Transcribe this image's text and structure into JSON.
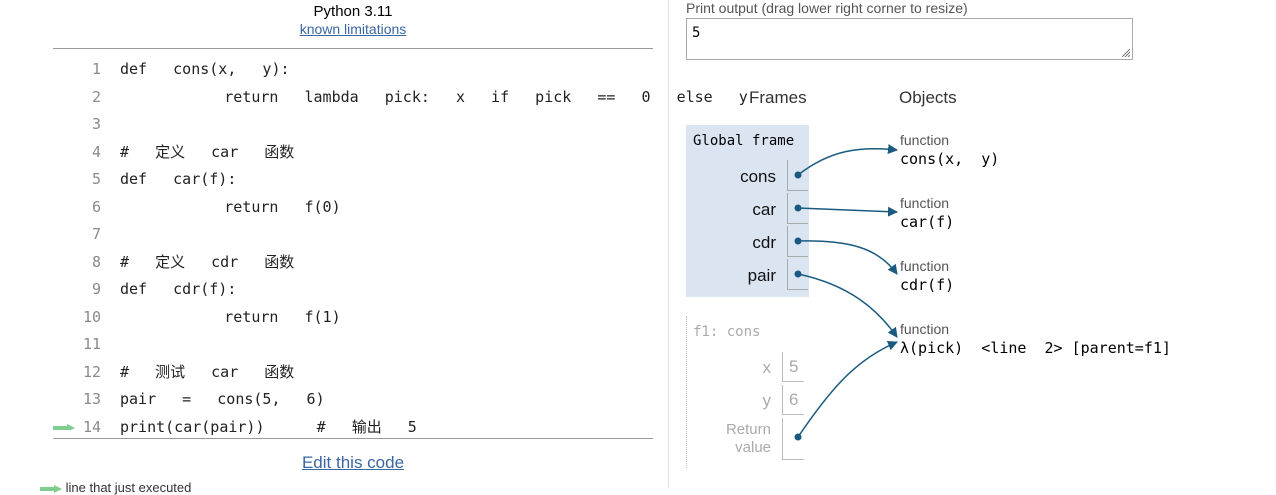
{
  "header": {
    "title": "Python 3.11",
    "limitations_link": "known limitations"
  },
  "code": {
    "lines": [
      {
        "n": "1",
        "text": "def  cons(x,  y):"
      },
      {
        "n": "2",
        "text": "        return  lambda  pick:  x  if  pick  ==  0  else  y"
      },
      {
        "n": "3",
        "text": ""
      },
      {
        "n": "4",
        "text": "#  定义  car  函数"
      },
      {
        "n": "5",
        "text": "def  car(f):"
      },
      {
        "n": "6",
        "text": "        return  f(0)"
      },
      {
        "n": "7",
        "text": ""
      },
      {
        "n": "8",
        "text": "#  定义  cdr  函数"
      },
      {
        "n": "9",
        "text": "def  cdr(f):"
      },
      {
        "n": "10",
        "text": "        return  f(1)"
      },
      {
        "n": "11",
        "text": ""
      },
      {
        "n": "12",
        "text": "#  测试  car  函数"
      },
      {
        "n": "13",
        "text": "pair  =  cons(5,  6)"
      },
      {
        "n": "14",
        "text": "print(car(pair))    #  输出  5"
      }
    ],
    "current_line": "14"
  },
  "edit_link": "Edit this code",
  "legend_text": "line that just executed",
  "output": {
    "label": "Print output (drag lower right corner to resize)",
    "value": "5"
  },
  "viz": {
    "frames_header": "Frames",
    "objects_header": "Objects",
    "global_frame": {
      "title": "Global frame",
      "vars": [
        "cons",
        "car",
        "cdr",
        "pair"
      ]
    },
    "objects": [
      {
        "type": "function",
        "value": "cons(x,  y)"
      },
      {
        "type": "function",
        "value": "car(f)"
      },
      {
        "type": "function",
        "value": "cdr(f)"
      },
      {
        "type": "function",
        "value": "λ(pick)  <line  2> [parent=f1]"
      }
    ],
    "f1_frame": {
      "title": "f1: cons",
      "vars": [
        {
          "name": "x",
          "value": "5"
        },
        {
          "name": "y",
          "value": "6"
        }
      ],
      "return_label": [
        "Return",
        "value"
      ]
    }
  },
  "colors": {
    "arrow": "#1a5a80",
    "current_line_arrow": "#7fce8f",
    "frame_bg": "#dbe5f1",
    "link": "#3a66a3"
  }
}
